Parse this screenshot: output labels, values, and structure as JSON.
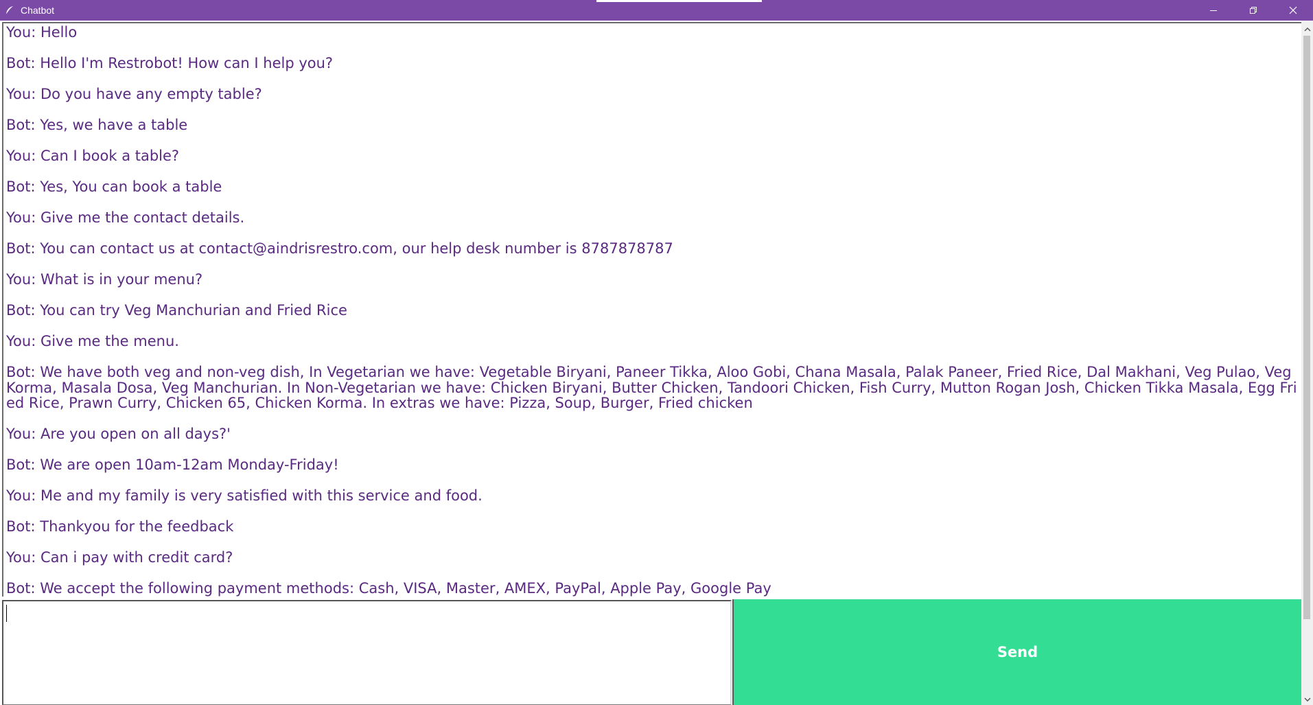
{
  "window": {
    "title": "Chatbot",
    "icon": "feather-icon",
    "controls": [
      "minimize-icon",
      "restore-icon",
      "close-icon"
    ],
    "titlebar_color": "#7a4aa6"
  },
  "chat": {
    "text_color": "#5a2a82",
    "messages": [
      "You: Hello",
      "Bot: Hello I'm Restrobot! How can I help you?",
      "You: Do you have any empty table?",
      "Bot: Yes, we have a table",
      "You: Can I book a table?",
      "Bot: Yes, You can book a table",
      "You: Give me the contact details.",
      "Bot: You can contact us at contact@aindrisrestro.com, our help desk number is 8787878787",
      "You: What is in your menu?",
      "Bot: You can try Veg Manchurian and Fried Rice",
      "You: Give me the menu.",
      "Bot: We have both veg and non-veg dish, In Vegetarian we have: Vegetable Biryani, Paneer Tikka, Aloo Gobi, Chana Masala, Palak Paneer, Fried Rice, Dal Makhani, Veg Pulao, Veg Korma, Masala Dosa, Veg Manchurian. In Non-Vegetarian we have: Chicken Biryani, Butter Chicken, Tandoori Chicken, Fish Curry, Mutton Rogan Josh, Chicken Tikka Masala, Egg Fried Rice, Prawn Curry, Chicken 65, Chicken Korma. In extras we have: Pizza, Soup, Burger, Fried chicken",
      "You: Are you open on all days?'",
      "Bot: We are open 10am-12am Monday-Friday!",
      "You: Me and my family is very satisfied with this service and food.",
      "Bot: Thankyou for the feedback",
      "You: Can i pay with credit card?",
      "Bot: We accept the following payment methods: Cash, VISA, Master, AMEX, PayPal, Apple Pay, Google Pay"
    ]
  },
  "input": {
    "value": "",
    "placeholder": ""
  },
  "send_button": {
    "label": "Send",
    "color": "#33dd94"
  }
}
